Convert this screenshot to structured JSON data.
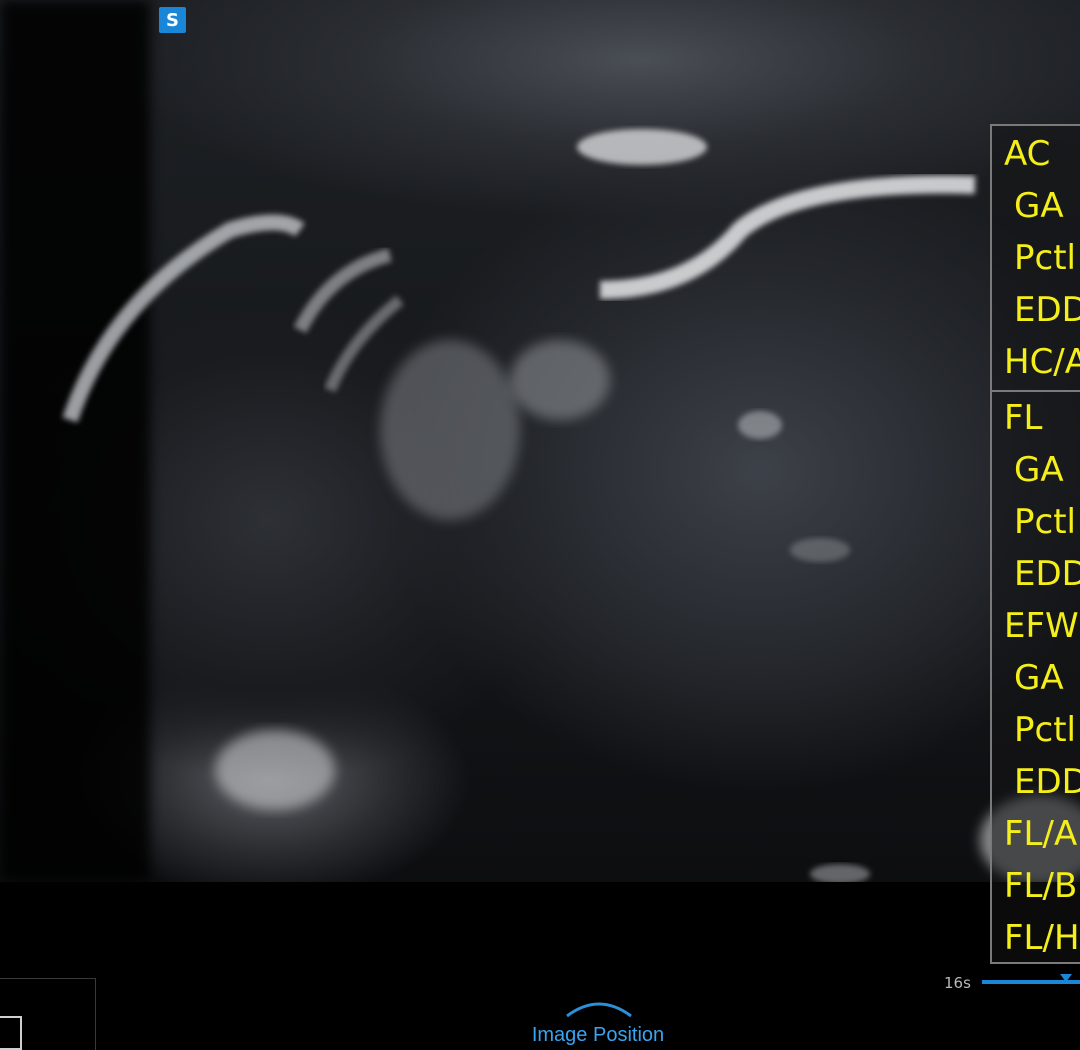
{
  "probe_badge": "S",
  "measurements": [
    {
      "label": "AC",
      "sub": false
    },
    {
      "label": "GA",
      "sub": true
    },
    {
      "label": "Pctl",
      "sub": true
    },
    {
      "label": "EDD",
      "sub": true
    },
    {
      "label": "HC/A",
      "sub": false
    },
    {
      "label": "FL",
      "sub": false
    },
    {
      "label": "GA",
      "sub": true
    },
    {
      "label": "Pctl",
      "sub": true
    },
    {
      "label": "EDD",
      "sub": true
    },
    {
      "label": "EFW",
      "sub": false
    },
    {
      "label": "GA",
      "sub": true
    },
    {
      "label": "Pctl",
      "sub": true
    },
    {
      "label": "EDD",
      "sub": true
    },
    {
      "label": "FL/A",
      "sub": false
    },
    {
      "label": "FL/B",
      "sub": false
    },
    {
      "label": "FL/H",
      "sub": false
    }
  ],
  "cine": {
    "label": "16s",
    "accent": "#1a86d8"
  },
  "image_position": {
    "label": "Image Position"
  },
  "colors": {
    "measurement_text": "#f4ee1b",
    "accent": "#3aa3f0"
  }
}
